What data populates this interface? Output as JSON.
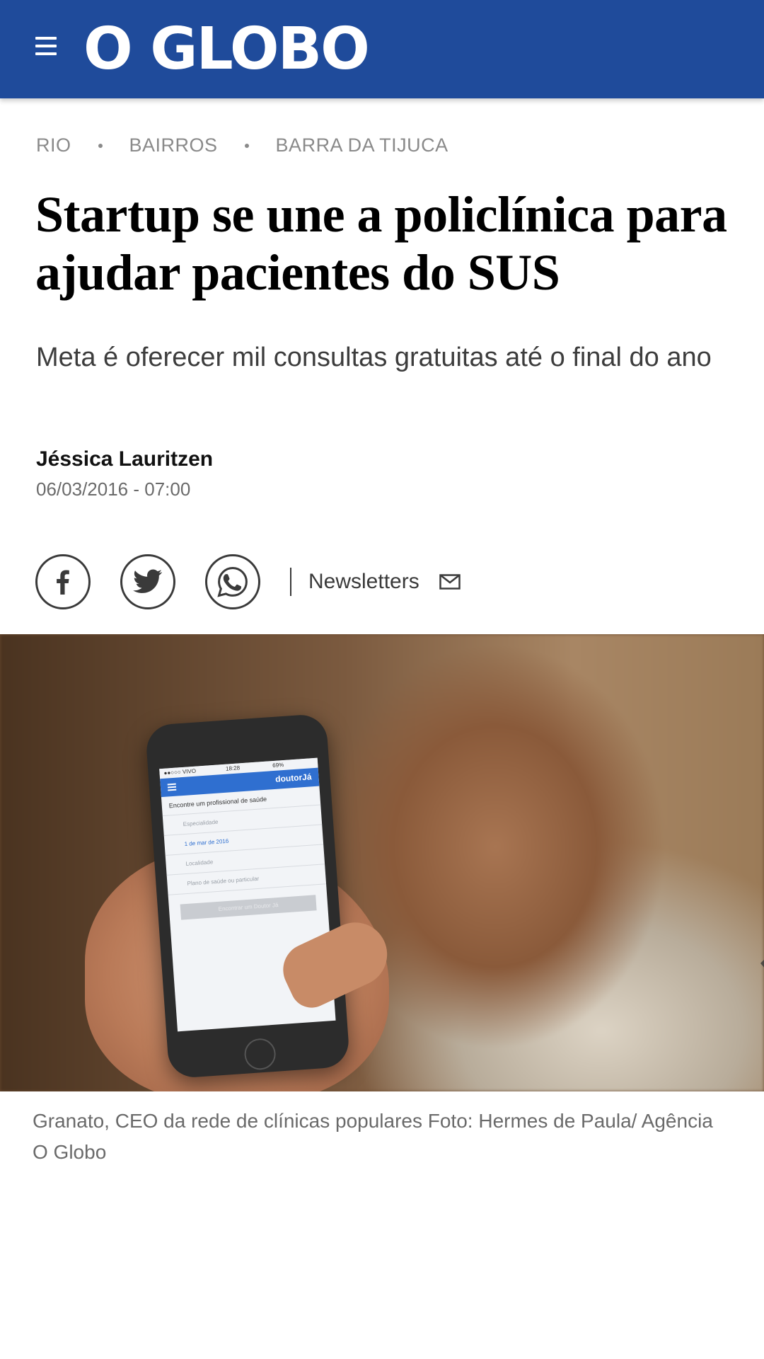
{
  "header": {
    "brand": "O GLOBO",
    "brand_color": "#1f4b9b",
    "menu_icon": "hamburger-menu-icon"
  },
  "breadcrumb": [
    "RIO",
    "BAIRROS",
    "BARRA DA TIJUCA"
  ],
  "article": {
    "headline": "Startup se une a policlínica para ajudar pacientes do SUS",
    "subheadline": "Meta é oferecer mil consultas gratuitas até o final do ano",
    "author": "Jéssica Lauritzen",
    "timestamp": "06/03/2016 - 07:00"
  },
  "share": {
    "icons": [
      "facebook-icon",
      "twitter-icon",
      "whatsapp-icon"
    ],
    "newsletters_label": "Newsletters",
    "newsletters_icon": "mail-icon"
  },
  "photo": {
    "screen_status": "●●○○○ VIVO",
    "screen_time": "18:28",
    "screen_battery": "69%",
    "screen_brand": "doutorJá",
    "screen_prompt": "Encontre um profissional de saúde",
    "screen_field1": "Especialidade",
    "screen_field2": "1 de mar de 2016",
    "screen_field3": "Localidade",
    "screen_field4": "Plano de saúde ou particular",
    "screen_button": "Encontrar um Doutor Já"
  },
  "caption": "Granato, CEO da rede de clínicas populares Foto: Hermes de Paula/ Agência O Globo"
}
